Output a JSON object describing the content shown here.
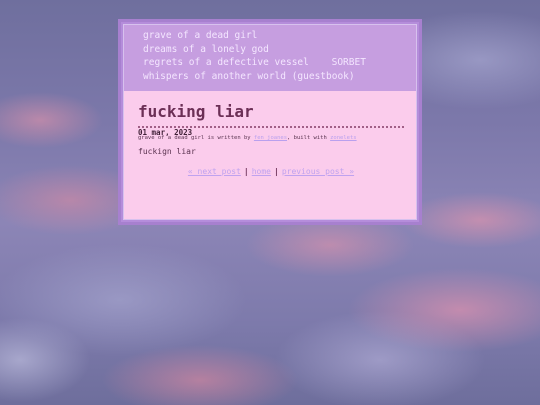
{
  "nav": {
    "row1": [
      {
        "glyph": "",
        "label": "grave of a dead girl"
      }
    ],
    "row2": [
      {
        "glyph": "",
        "label": "dreams of a lonely god"
      }
    ],
    "row3": [
      {
        "glyph": "",
        "label": "regrets of a defective vessel"
      },
      {
        "glyph": "",
        "label": "SORBET"
      }
    ],
    "row4": [
      {
        "glyph": "",
        "label": "whispers of another world (guestbook)"
      }
    ]
  },
  "post": {
    "title": "fucking liar",
    "date": "01 mar, 2023",
    "body": "fuckign liar"
  },
  "pager": {
    "next": "« next post",
    "separator": "|",
    "home": "home",
    "previous": "previous post »"
  },
  "footer": {
    "prefix": "grave of a dead girl is written by",
    "author": "fen joanes",
    "middle": ", built with",
    "tool": "zonelets"
  },
  "colors": {
    "frame_border": "#a780cf",
    "nav_background": "#c69ee0",
    "content_background": "#fbccec",
    "title": "#6c2f56",
    "link": "#bfa2ef"
  }
}
